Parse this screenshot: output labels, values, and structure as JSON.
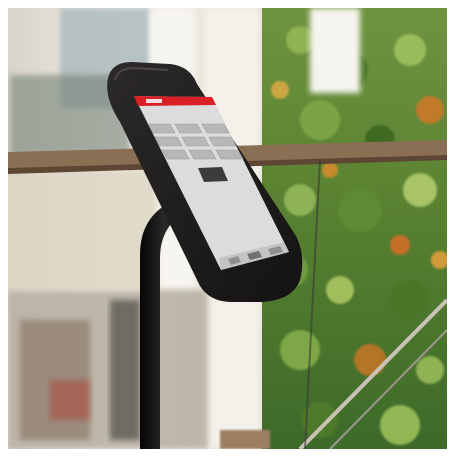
{
  "photo": {
    "subject": "kiosk-tablet-on-stand",
    "screen": {
      "header_color": "#d92027",
      "body_color": "#dcdcdc",
      "tile_count": 9,
      "center_button_count": 1,
      "footer_button_count": 3
    },
    "colors": {
      "frame": "#ffffff",
      "wall": "#e6e2d8",
      "plant_green": "#5f8a35",
      "plant_leaf_accent": "#c07a2a",
      "rail": "#8a6f55",
      "tablet_shell": "#1f1d1d",
      "pole": "#141414"
    }
  }
}
